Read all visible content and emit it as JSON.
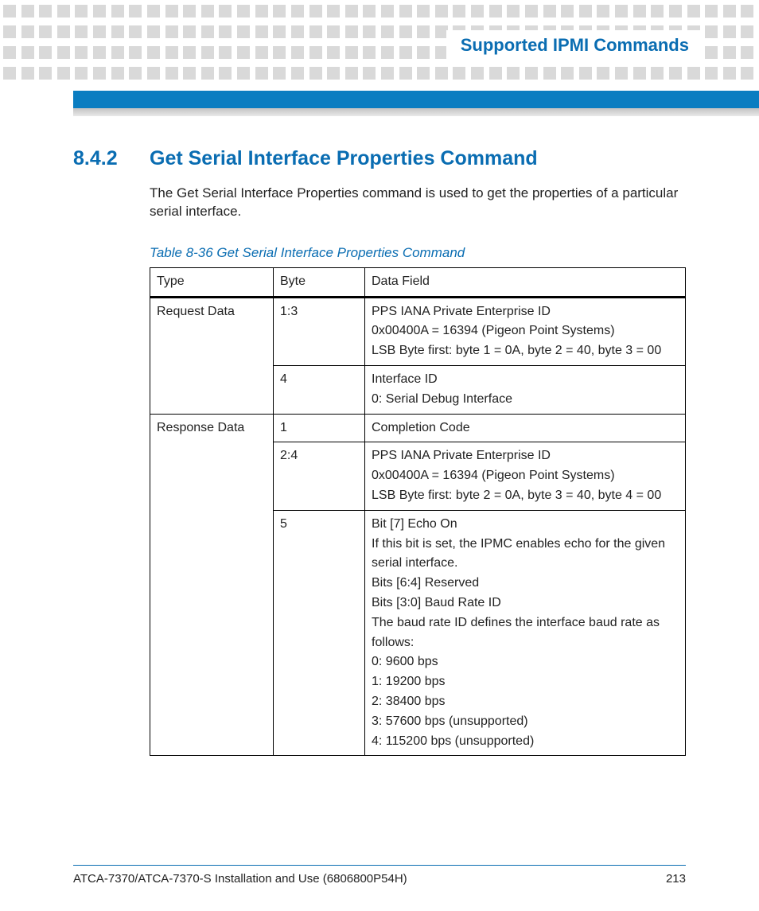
{
  "header": {
    "chapter_title": "Supported IPMI Commands"
  },
  "section": {
    "number": "8.4.2",
    "title": "Get Serial Interface Properties Command",
    "intro": "The Get Serial Interface Properties command is used to get the properties of a particular serial interface."
  },
  "table": {
    "caption": "Table 8-36 Get Serial Interface Properties Command",
    "headers": {
      "type": "Type",
      "byte": "Byte",
      "data": "Data Field"
    },
    "rows": [
      {
        "type": "Request Data",
        "type_rowspan": 2,
        "byte": "1:3",
        "data": "PPS IANA Private Enterprise ID\n0x00400A = 16394 (Pigeon Point Systems)\nLSB Byte first: byte 1 = 0A, byte 2 = 40, byte 3 = 00"
      },
      {
        "byte": "4",
        "data": "Interface ID\n0: Serial Debug Interface"
      },
      {
        "type": "Response Data",
        "type_rowspan": 3,
        "byte": "1",
        "data": "Completion Code"
      },
      {
        "byte": "2:4",
        "data": "PPS IANA Private Enterprise ID\n0x00400A = 16394 (Pigeon Point Systems)\nLSB Byte first: byte 2 = 0A, byte 3 = 40, byte 4 = 00"
      },
      {
        "byte": "5",
        "data": "Bit [7] Echo On\nIf this bit is set, the IPMC enables echo for the given serial interface.\nBits [6:4] Reserved\nBits [3:0] Baud Rate ID\nThe baud rate ID defines the interface baud rate as follows:\n0: 9600 bps\n1: 19200 bps\n2: 38400 bps\n3: 57600 bps (unsupported)\n4: 115200 bps (unsupported)"
      }
    ]
  },
  "footer": {
    "doc_title": "ATCA-7370/ATCA-7370-S Installation and Use (6806800P54H)",
    "page_number": "213"
  }
}
